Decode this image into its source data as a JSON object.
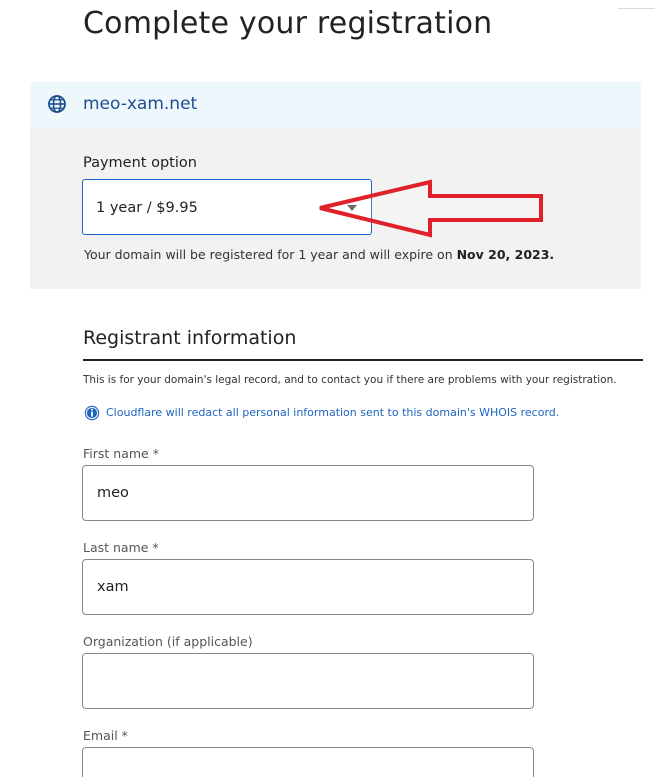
{
  "page": {
    "title": "Complete your registration"
  },
  "domain": {
    "name": "meo-xam.net",
    "icon": "globe-icon"
  },
  "payment": {
    "label": "Payment option",
    "selected": "1 year / $9.95",
    "note_prefix": "Your domain will be registered for 1 year and will expire on ",
    "expiry_date": "Nov 20, 2023."
  },
  "registrant": {
    "title": "Registrant information",
    "description": "This is for your domain's legal record, and to contact you if there are problems with your registration.",
    "redact_note": "Cloudflare will redact all personal information sent to this domain's WHOIS record.",
    "fields": {
      "first_name": {
        "label": "First name *",
        "value": "meo"
      },
      "last_name": {
        "label": "Last name *",
        "value": "xam"
      },
      "organization": {
        "label": "Organization (if applicable)",
        "value": ""
      },
      "email": {
        "label": "Email *",
        "value": ""
      }
    }
  },
  "colors": {
    "accent": "#1b64c9",
    "link": "#1f64c0",
    "domain_text": "#1f4e8f",
    "domain_bar_bg": "#eef7fc",
    "panel_bg": "#f2f2f2",
    "annotation_arrow": "#e0202a"
  }
}
